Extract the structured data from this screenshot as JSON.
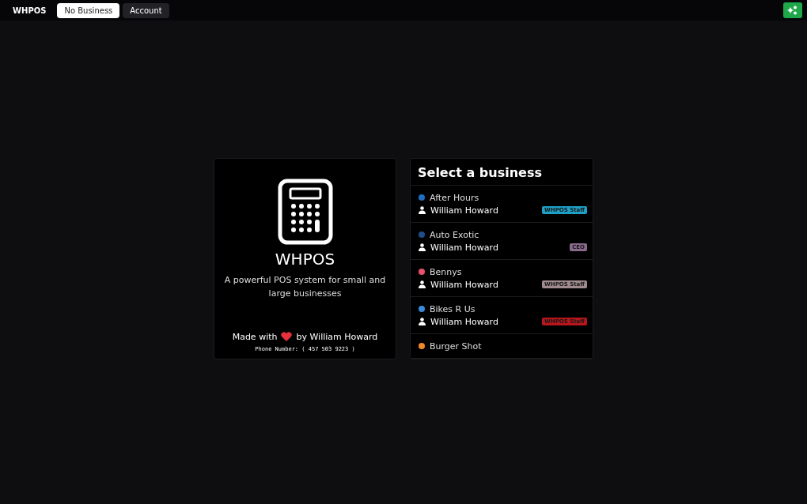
{
  "nav": {
    "brand": "WHPOS",
    "tabs": [
      {
        "label": "No Business",
        "selected": true
      },
      {
        "label": "Account",
        "selected": false
      }
    ]
  },
  "intro": {
    "title": "WHPOS",
    "tagline": "A powerful POS system for small and large businesses",
    "made_with_before": "Made with",
    "made_with_after": "by William Howard",
    "phone": "Phone Number: ( 457 503 9223 )"
  },
  "businesses": {
    "title": "Select a business",
    "items": [
      {
        "name": "After Hours",
        "color": "#1e6fc0",
        "owner": "William Howard",
        "role": {
          "label": "WHPOS Staff",
          "color": "#1e9fc6"
        }
      },
      {
        "name": "Auto Exotic",
        "color": "#1f4f8a",
        "owner": "William Howard",
        "role": {
          "label": "CEO",
          "color": "#8a6a8c"
        }
      },
      {
        "name": "Bennys",
        "color": "#e8506e",
        "owner": "William Howard",
        "role": {
          "label": "WHPOS Staff",
          "color": "#a08a8e"
        }
      },
      {
        "name": "Bikes R Us",
        "color": "#3a8ad8",
        "owner": "William Howard",
        "role": {
          "label": "WHPOS Staff",
          "color": "#b8161c"
        }
      },
      {
        "name": "Burger Shot",
        "color": "#f0882a"
      }
    ]
  }
}
